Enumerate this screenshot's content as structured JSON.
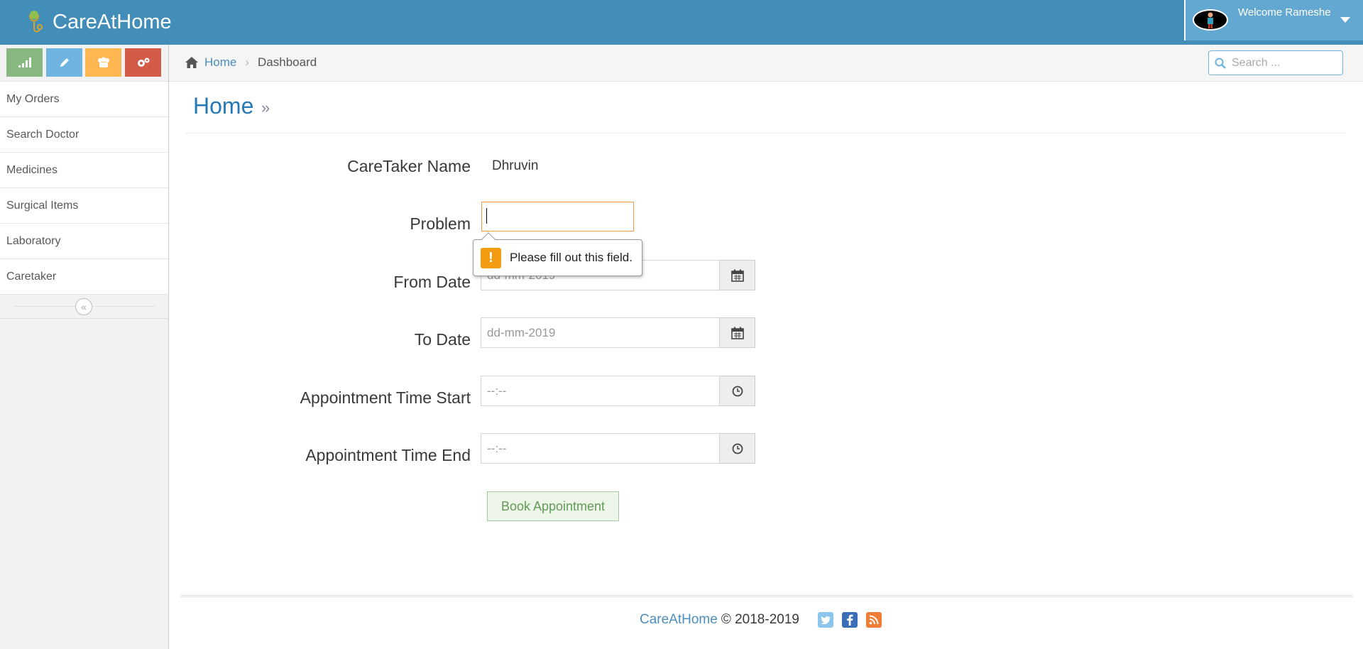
{
  "app": {
    "name": "CareAtHome"
  },
  "user": {
    "welcome": "Welcome Rameshe"
  },
  "sidebar": {
    "shortcuts": [
      {
        "icon": "signal-icon",
        "color": "#87b87f"
      },
      {
        "icon": "pencil-icon",
        "color": "#6fb3e0"
      },
      {
        "icon": "users-icon",
        "color": "#ffb752"
      },
      {
        "icon": "cogs-icon",
        "color": "#d15b47"
      }
    ],
    "items": [
      {
        "label": "My Orders"
      },
      {
        "label": "Search Doctor"
      },
      {
        "label": "Medicines"
      },
      {
        "label": "Surgical Items"
      },
      {
        "label": "Laboratory"
      },
      {
        "label": "Caretaker"
      }
    ]
  },
  "breadcrumb": {
    "home": "Home",
    "separator": "›",
    "current": "Dashboard"
  },
  "search": {
    "placeholder": "Search ..."
  },
  "page": {
    "title": "Home",
    "title_suffix": "»"
  },
  "form": {
    "caretaker_label": "CareTaker Name",
    "caretaker_value": "Dhruvin",
    "problem_label": "Problem",
    "problem_value": "",
    "from_date_label": "From Date",
    "from_date_placeholder": "dd-mm-2019",
    "to_date_label": "To Date",
    "to_date_placeholder": "dd-mm-2019",
    "time_start_label": "Appointment Time Start",
    "time_start_placeholder": "--:--",
    "time_end_label": "Appointment Time End",
    "time_end_placeholder": "--:--",
    "submit_label": "Book Appointment"
  },
  "validation": {
    "message": "Please fill out this field.",
    "icon": "!"
  },
  "footer": {
    "brand": "CareAtHome",
    "copyright": "© 2018-2019"
  },
  "colors": {
    "navbar": "#438eb9",
    "accent": "#2679b5",
    "focus_border": "#f59942",
    "button_success": "#629b58"
  }
}
